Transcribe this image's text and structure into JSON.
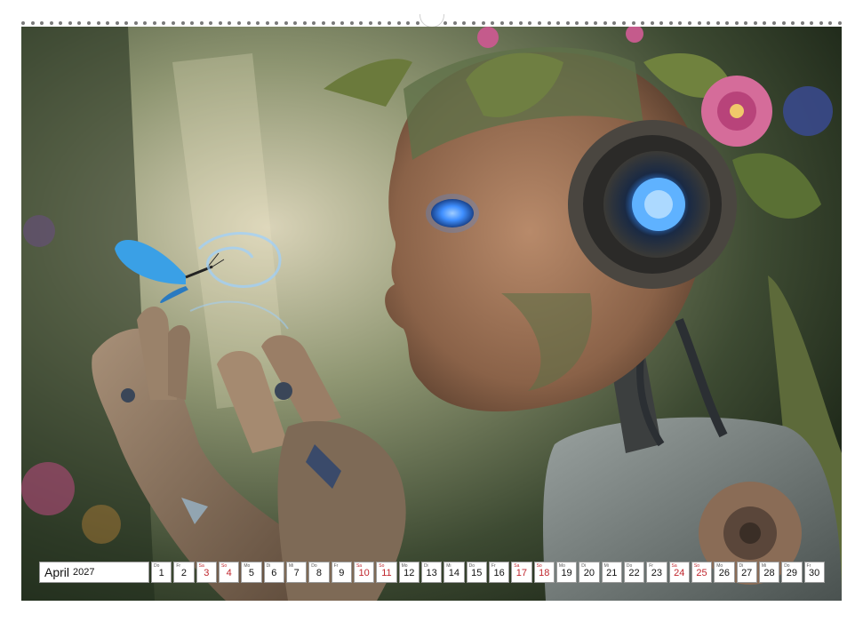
{
  "calendar": {
    "month": "April",
    "year": "2027",
    "days": [
      {
        "wd": "Do",
        "num": "1",
        "weekend": false
      },
      {
        "wd": "Fr",
        "num": "2",
        "weekend": false
      },
      {
        "wd": "Sa",
        "num": "3",
        "weekend": true
      },
      {
        "wd": "So",
        "num": "4",
        "weekend": true
      },
      {
        "wd": "Mo",
        "num": "5",
        "weekend": false
      },
      {
        "wd": "Di",
        "num": "6",
        "weekend": false
      },
      {
        "wd": "Mi",
        "num": "7",
        "weekend": false
      },
      {
        "wd": "Do",
        "num": "8",
        "weekend": false
      },
      {
        "wd": "Fr",
        "num": "9",
        "weekend": false
      },
      {
        "wd": "Sa",
        "num": "10",
        "weekend": true
      },
      {
        "wd": "So",
        "num": "11",
        "weekend": true
      },
      {
        "wd": "Mo",
        "num": "12",
        "weekend": false
      },
      {
        "wd": "Di",
        "num": "13",
        "weekend": false
      },
      {
        "wd": "Mi",
        "num": "14",
        "weekend": false
      },
      {
        "wd": "Do",
        "num": "15",
        "weekend": false
      },
      {
        "wd": "Fr",
        "num": "16",
        "weekend": false
      },
      {
        "wd": "Sa",
        "num": "17",
        "weekend": true
      },
      {
        "wd": "So",
        "num": "18",
        "weekend": true
      },
      {
        "wd": "Mo",
        "num": "19",
        "weekend": false
      },
      {
        "wd": "Di",
        "num": "20",
        "weekend": false
      },
      {
        "wd": "Mi",
        "num": "21",
        "weekend": false
      },
      {
        "wd": "Do",
        "num": "22",
        "weekend": false
      },
      {
        "wd": "Fr",
        "num": "23",
        "weekend": false
      },
      {
        "wd": "Sa",
        "num": "24",
        "weekend": true
      },
      {
        "wd": "So",
        "num": "25",
        "weekend": true
      },
      {
        "wd": "Mo",
        "num": "26",
        "weekend": false
      },
      {
        "wd": "Di",
        "num": "27",
        "weekend": false
      },
      {
        "wd": "Mi",
        "num": "28",
        "weekend": false
      },
      {
        "wd": "Do",
        "num": "29",
        "weekend": false
      },
      {
        "wd": "Fr",
        "num": "30",
        "weekend": false
      }
    ]
  },
  "colors": {
    "weekend": "#c0262d",
    "eye_glow": "#3f8fff",
    "butterfly": "#3aa0e6"
  }
}
